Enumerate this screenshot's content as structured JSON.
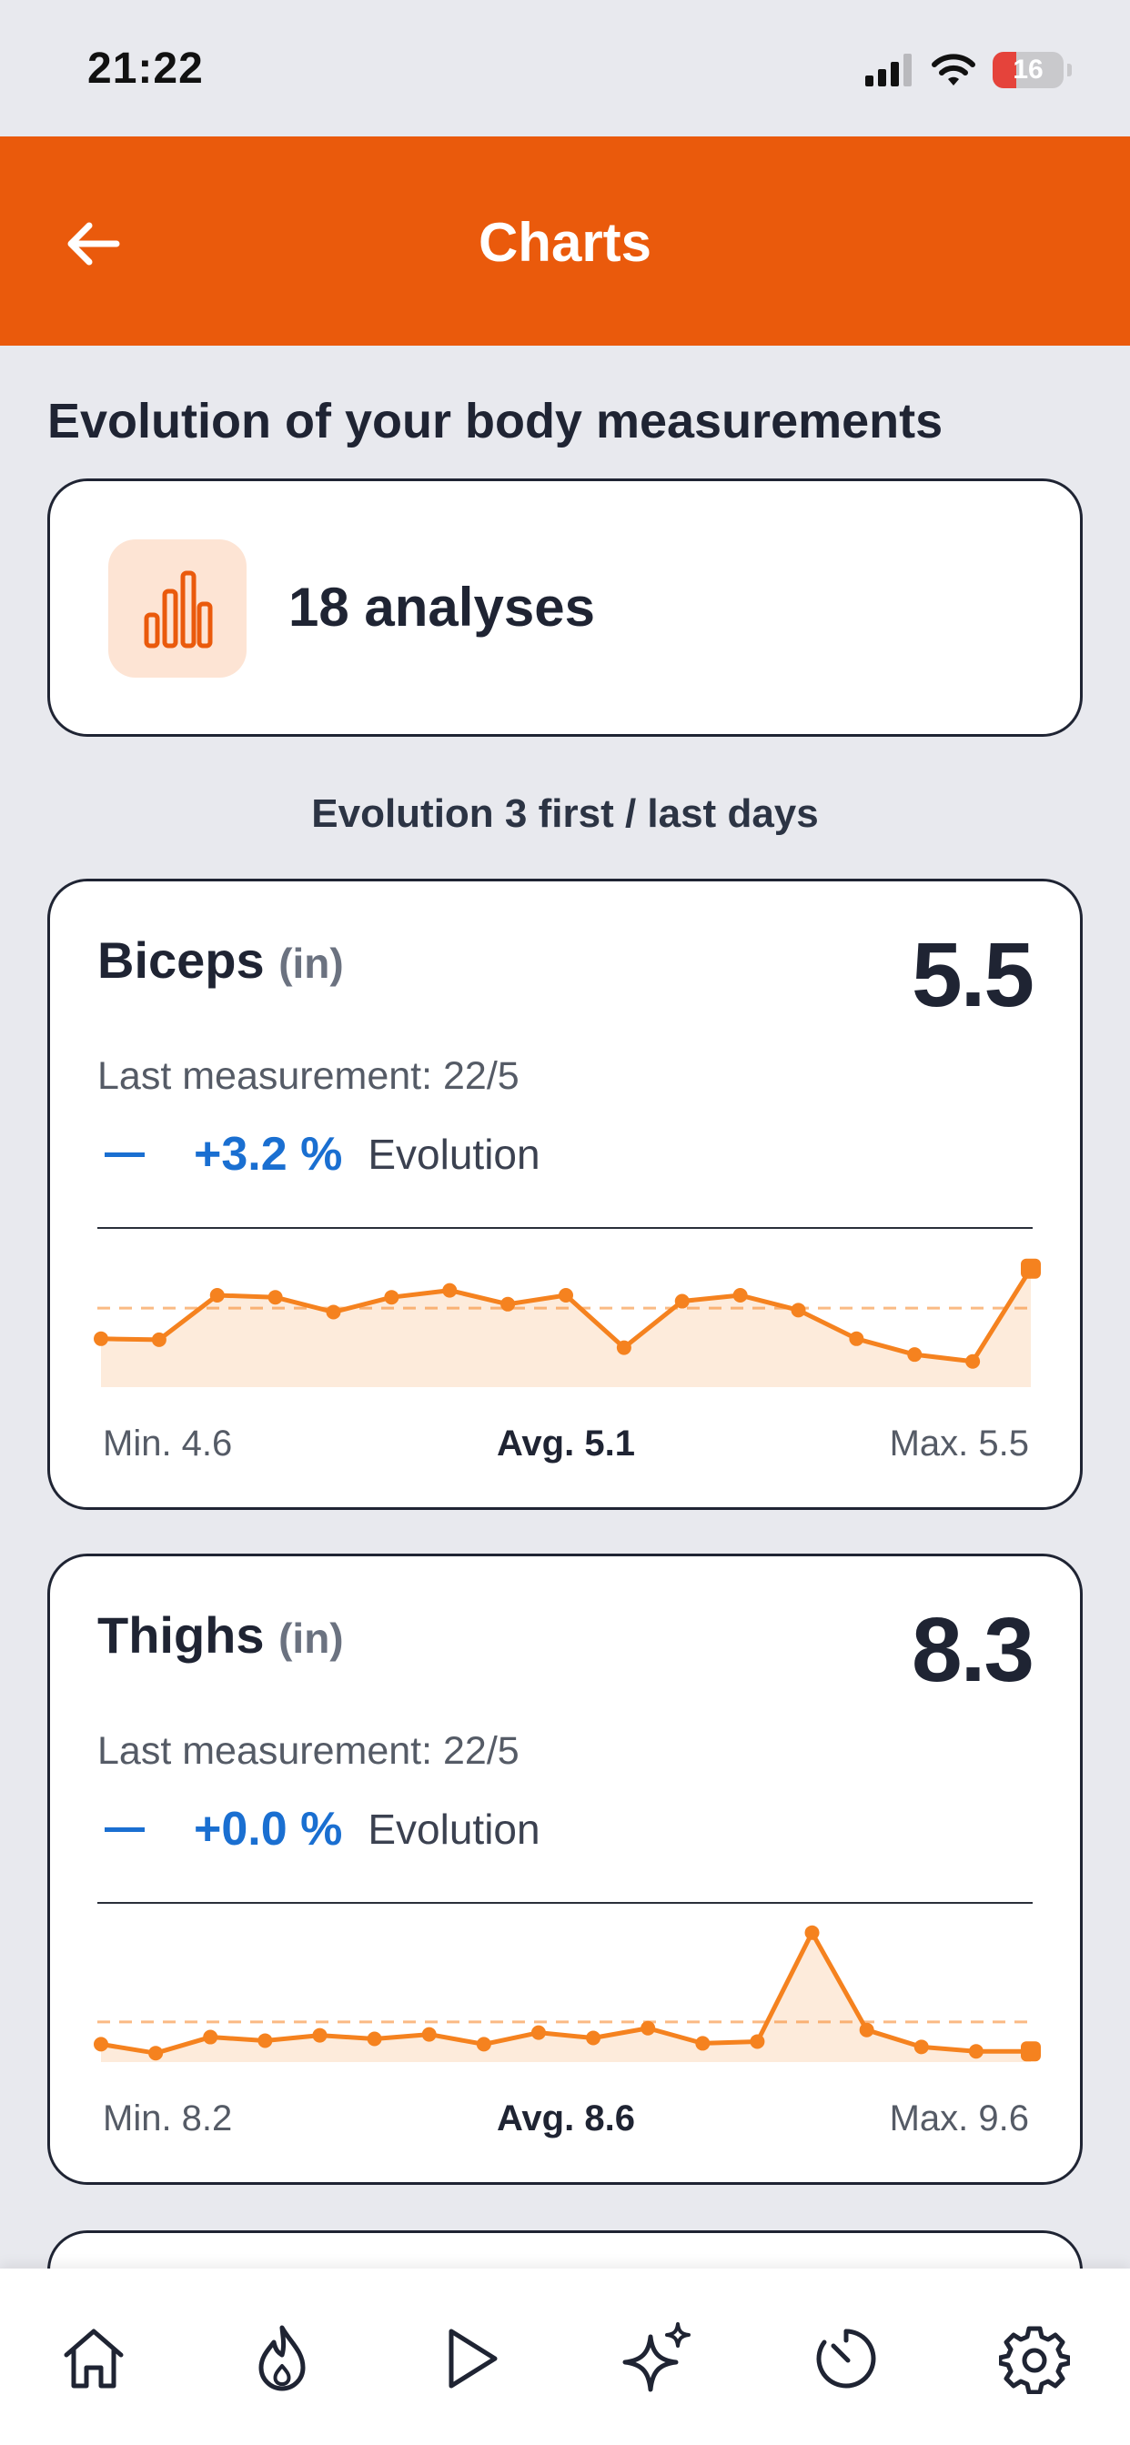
{
  "status": {
    "time": "21:22",
    "battery": "16"
  },
  "header": {
    "title": "Charts"
  },
  "section_title": "Evolution of your body measurements",
  "analyses": {
    "label": "18 analyses"
  },
  "evolution_subtitle": "Evolution 3 first / last days",
  "metrics": [
    {
      "name": "Biceps",
      "unit": "(in)",
      "value": "5.5",
      "last_measurement": "Last measurement: 22/5",
      "evolution_pct": "+3.2 %",
      "evolution_label": "Evolution",
      "min": "Min. 4.6",
      "avg": "Avg. 5.1",
      "max": "Max. 5.5"
    },
    {
      "name": "Thighs",
      "unit": "(in)",
      "value": "8.3",
      "last_measurement": "Last measurement: 22/5",
      "evolution_pct": "+0.0 %",
      "evolution_label": "Evolution",
      "min": "Min. 8.2",
      "avg": "Avg. 8.6",
      "max": "Max. 9.6"
    }
  ],
  "chart_data": [
    {
      "type": "area",
      "y": [
        4.79,
        4.78,
        5.23,
        5.21,
        5.06,
        5.21,
        5.28,
        5.14,
        5.23,
        4.7,
        5.17,
        5.23,
        5.08,
        4.79,
        4.63,
        4.56,
        5.5
      ],
      "average": 5.1,
      "min": 4.6,
      "max": 5.5,
      "ylim": [
        4.3,
        5.7
      ],
      "grid": false,
      "color": "#f5821f"
    },
    {
      "type": "area",
      "y": [
        8.35,
        8.25,
        8.43,
        8.39,
        8.45,
        8.41,
        8.46,
        8.35,
        8.48,
        8.42,
        8.53,
        8.36,
        8.38,
        9.6,
        8.51,
        8.32,
        8.27,
        8.27
      ],
      "average": 8.6,
      "min": 8.2,
      "max": 9.6,
      "ylim": [
        8.15,
        9.7
      ],
      "grid": false,
      "color": "#f5821f"
    }
  ],
  "nav": {
    "items": [
      {
        "icon": "home-icon"
      },
      {
        "icon": "flame-icon"
      },
      {
        "icon": "play-icon"
      },
      {
        "icon": "sparkles-icon"
      },
      {
        "icon": "timer-icon"
      },
      {
        "icon": "gear-icon"
      }
    ]
  },
  "colors": {
    "brand": "#ea5a0c",
    "accent": "#f5821f",
    "evolution": "#1a6fd1"
  }
}
